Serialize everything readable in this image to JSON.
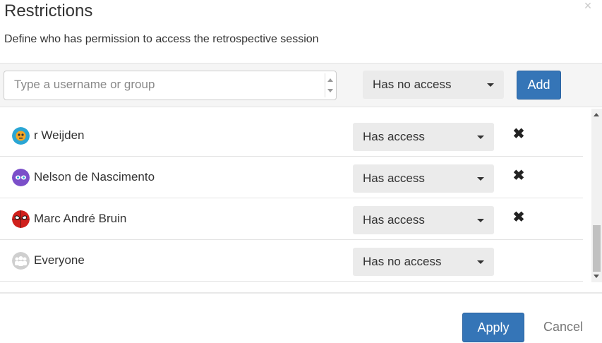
{
  "dialog": {
    "title": "Restrictions",
    "subtitle": "Define who has permission to access the retrospective session"
  },
  "add_bar": {
    "input_placeholder": "Type a username or group",
    "input_value": "",
    "access_select": "Has no access",
    "add_label": "Add"
  },
  "rows": [
    {
      "name": "r Weijden",
      "avatar": "orange-blob-avatar",
      "access": "Has access",
      "removable": true
    },
    {
      "name": "Nelson de Nascimento",
      "avatar": "purple-mask-avatar",
      "access": "Has access",
      "removable": true
    },
    {
      "name": "Marc André Bruin",
      "avatar": "spiderman-avatar",
      "access": "Has access",
      "removable": true
    },
    {
      "name": "Everyone",
      "avatar": "group-icon",
      "access": "Has no access",
      "removable": false
    }
  ],
  "footer": {
    "apply_label": "Apply",
    "cancel_label": "Cancel"
  },
  "colors": {
    "primary": "#3575b7",
    "select_bg": "#ebebeb",
    "bar_bg": "#f5f5f5"
  }
}
